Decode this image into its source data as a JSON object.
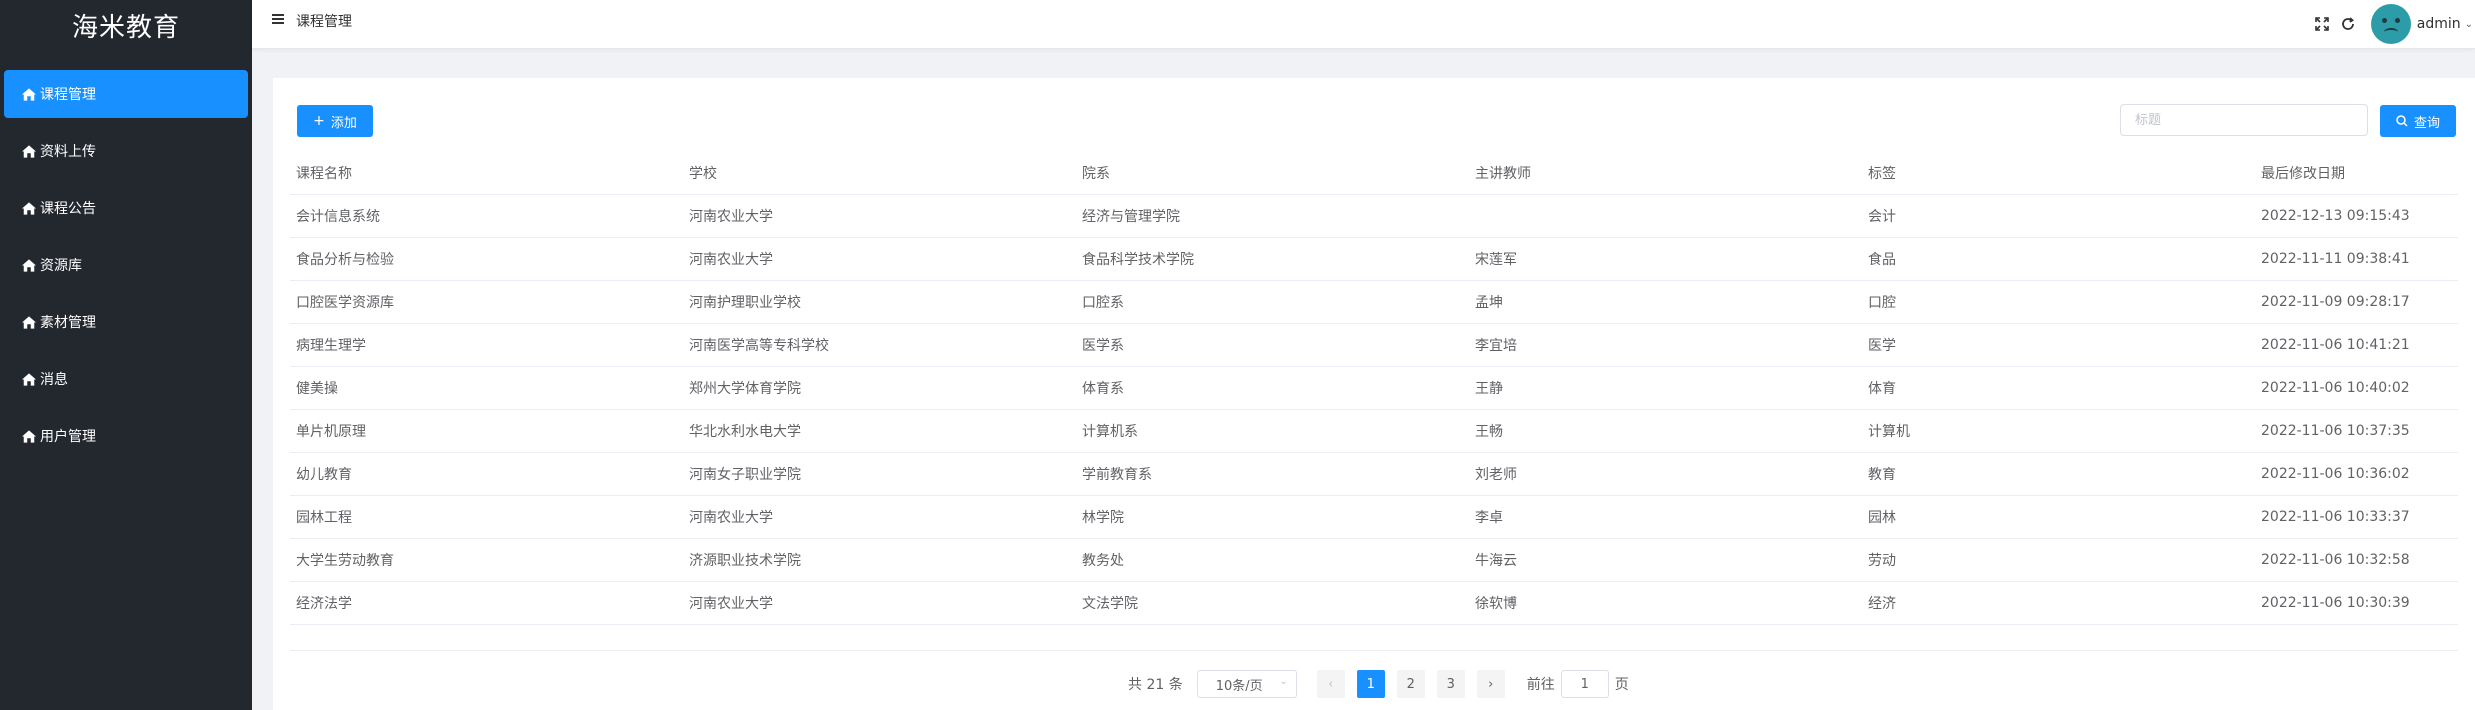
{
  "app": {
    "title": "海米教育"
  },
  "sidebar": {
    "items": [
      {
        "label": "课程管理",
        "active": true
      },
      {
        "label": "资料上传"
      },
      {
        "label": "课程公告"
      },
      {
        "label": "资源库"
      },
      {
        "label": "素材管理"
      },
      {
        "label": "消息"
      },
      {
        "label": "用户管理"
      }
    ]
  },
  "header": {
    "breadcrumb": "课程管理",
    "username": "admin"
  },
  "toolbar": {
    "add_label": "添加",
    "search_placeholder": "标题",
    "query_label": "查询"
  },
  "table": {
    "columns": [
      "课程名称",
      "学校",
      "院系",
      "主讲教师",
      "标签",
      "最后修改日期"
    ],
    "rows": [
      [
        "会计信息系统",
        "河南农业大学",
        "经济与管理学院",
        "",
        "会计",
        "2022-12-13 09:15:43"
      ],
      [
        "食品分析与检验",
        "河南农业大学",
        "食品科学技术学院",
        "宋莲军",
        "食品",
        "2022-11-11 09:38:41"
      ],
      [
        "口腔医学资源库",
        "河南护理职业学校",
        "口腔系",
        "孟坤",
        "口腔",
        "2022-11-09 09:28:17"
      ],
      [
        "病理生理学",
        "河南医学高等专科学校",
        "医学系",
        "李宜培",
        "医学",
        "2022-11-06 10:41:21"
      ],
      [
        "健美操",
        "郑州大学体育学院",
        "体育系",
        "王静",
        "体育",
        "2022-11-06 10:40:02"
      ],
      [
        "单片机原理",
        "华北水利水电大学",
        "计算机系",
        "王畅",
        "计算机",
        "2022-11-06 10:37:35"
      ],
      [
        "幼儿教育",
        "河南女子职业学院",
        "学前教育系",
        "刘老师",
        "教育",
        "2022-11-06 10:36:02"
      ],
      [
        "园林工程",
        "河南农业大学",
        "林学院",
        "李卓",
        "园林",
        "2022-11-06 10:33:37"
      ],
      [
        "大学生劳动教育",
        "济源职业技术学院",
        "教务处",
        "牛海云",
        "劳动",
        "2022-11-06 10:32:58"
      ],
      [
        "经济法学",
        "河南农业大学",
        "文法学院",
        "徐软博",
        "经济",
        "2022-11-06 10:30:39"
      ]
    ]
  },
  "pagination": {
    "total_label": "共 21 条",
    "page_size": "10条/页",
    "pages": [
      "1",
      "2",
      "3"
    ],
    "current": "1",
    "goto_prefix": "前往",
    "goto_value": "1",
    "goto_suffix": "页"
  },
  "colors": {
    "sidebar_bg": "#23272e",
    "accent": "#1890ff"
  },
  "icons": {
    "menu": "home-icon",
    "search": "search-icon",
    "fullscreen": "fullscreen-icon",
    "refresh": "refresh-icon"
  }
}
